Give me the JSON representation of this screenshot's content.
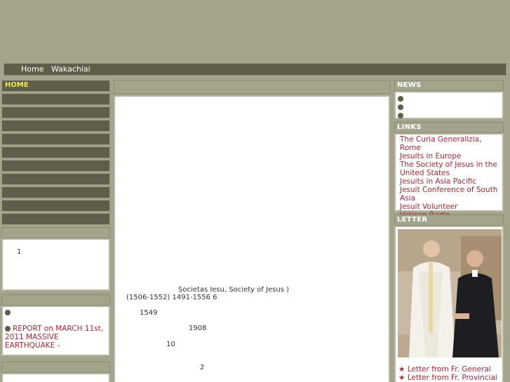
{
  "topnav": {
    "home": "Home",
    "wakachiai": "Wakachiai"
  },
  "left": {
    "home_label": "HOME",
    "panel1_text": "1",
    "report": "REPORT on MARCH 11st, 2011 MASSIVE EARTHQUAKE -"
  },
  "center": {
    "line1": "Societas Iesu,      Society of Jesus         )",
    "line2": "(1506-1552)            1491-1556  6",
    "line3": "1549",
    "line4": "1908",
    "line5": "10",
    "line6": "2"
  },
  "news": {
    "title": "NEWS"
  },
  "links": {
    "title": "LINKS",
    "items": [
      "The Curia Generalizia, Rome",
      "Jesuits in Europe",
      "The Society of Jesus in the United States",
      "Jesuits in Asia Pacific",
      "Jesuit Conference of South Asia",
      "Jesuit Volunteer",
      "Vatican Radio"
    ]
  },
  "letter": {
    "title": "LETTER",
    "items": [
      "Letter from Fr. General",
      "Letter from Fr. Provincial"
    ]
  },
  "colors": {
    "olive": "#a4a48c",
    "dark": "#5e5e4a",
    "link": "#a32a34",
    "home": "#f3e84b"
  }
}
